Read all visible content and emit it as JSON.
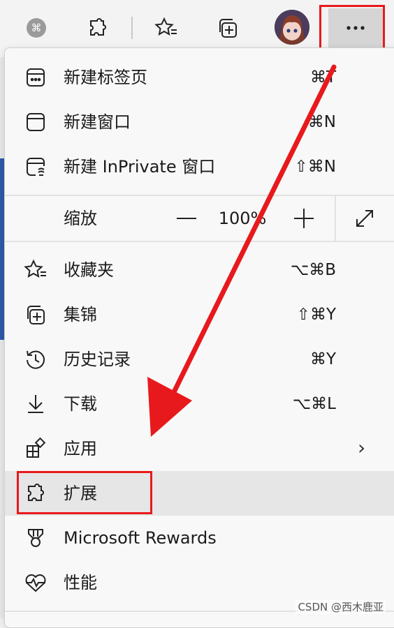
{
  "toolbar": {
    "icons": [
      "app-icon",
      "extensions-puzzle-icon",
      "favorites-star-icon",
      "collections-icon",
      "profile-avatar",
      "more-dots-icon"
    ]
  },
  "menu": {
    "items": [
      {
        "label": "新建标签页",
        "shortcut": "⌘T",
        "icon": "new-tab-icon"
      },
      {
        "label": "新建窗口",
        "shortcut": "⌘N",
        "icon": "new-window-icon"
      },
      {
        "label": "新建 InPrivate 窗口",
        "shortcut": "⇧⌘N",
        "icon": "inprivate-icon"
      },
      {
        "label": "收藏夹",
        "shortcut": "⌥⌘B",
        "icon": "favorites-icon"
      },
      {
        "label": "集锦",
        "shortcut": "⇧⌘Y",
        "icon": "collections-icon"
      },
      {
        "label": "历史记录",
        "shortcut": "⌘Y",
        "icon": "history-icon"
      },
      {
        "label": "下载",
        "shortcut": "⌥⌘L",
        "icon": "download-icon"
      },
      {
        "label": "应用",
        "shortcut": "",
        "icon": "apps-icon",
        "has_submenu": true
      },
      {
        "label": "扩展",
        "shortcut": "",
        "icon": "extensions-icon",
        "highlighted": true
      },
      {
        "label": "Microsoft Rewards",
        "shortcut": "",
        "icon": "rewards-icon"
      },
      {
        "label": "性能",
        "shortcut": "",
        "icon": "performance-icon"
      }
    ],
    "zoom": {
      "label": "缩放",
      "minus": "—",
      "value": "100%",
      "plus": "+",
      "fullscreen_icon": "fullscreen-icon"
    },
    "submenu_chevron": "›"
  },
  "watermark": "CSDN @西木鹿亚",
  "colors": {
    "annotation_red": "#e8191c",
    "menu_bg": "#f8f8f8",
    "highlight_bg": "#e6e6e6"
  }
}
